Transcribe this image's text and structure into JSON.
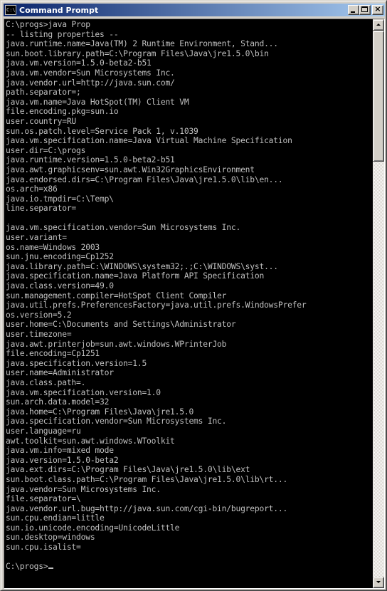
{
  "window": {
    "title": "Command Prompt",
    "icon_name": "console-icon",
    "icon_text": "C:\\",
    "buttons": [
      "minimize",
      "maximize",
      "close"
    ],
    "close_glyph": "×"
  },
  "colors": {
    "title_start": "#0a246a",
    "title_end": "#a6caf0",
    "console_bg": "#000000",
    "console_fg": "#c0c0c0",
    "chrome": "#d4d0c8"
  },
  "console": {
    "lines": [
      "C:\\progs>java Prop",
      "-- listing properties --",
      "java.runtime.name=Java(TM) 2 Runtime Environment, Stand...",
      "sun.boot.library.path=C:\\Program Files\\Java\\jre1.5.0\\bin",
      "java.vm.version=1.5.0-beta2-b51",
      "java.vm.vendor=Sun Microsystems Inc.",
      "java.vendor.url=http://java.sun.com/",
      "path.separator=;",
      "java.vm.name=Java HotSpot(TM) Client VM",
      "file.encoding.pkg=sun.io",
      "user.country=RU",
      "sun.os.patch.level=Service Pack 1, v.1039",
      "java.vm.specification.name=Java Virtual Machine Specification",
      "user.dir=C:\\progs",
      "java.runtime.version=1.5.0-beta2-b51",
      "java.awt.graphicsenv=sun.awt.Win32GraphicsEnvironment",
      "java.endorsed.dirs=C:\\Program Files\\Java\\jre1.5.0\\lib\\en...",
      "os.arch=x86",
      "java.io.tmpdir=C:\\Temp\\",
      "line.separator=",
      "",
      "java.vm.specification.vendor=Sun Microsystems Inc.",
      "user.variant=",
      "os.name=Windows 2003",
      "sun.jnu.encoding=Cp1252",
      "java.library.path=C:\\WINDOWS\\system32;.;C:\\WINDOWS\\syst...",
      "java.specification.name=Java Platform API Specification",
      "java.class.version=49.0",
      "sun.management.compiler=HotSpot Client Compiler",
      "java.util.prefs.PreferencesFactory=java.util.prefs.WindowsPrefer",
      "os.version=5.2",
      "user.home=C:\\Documents and Settings\\Administrator",
      "user.timezone=",
      "java.awt.printerjob=sun.awt.windows.WPrinterJob",
      "file.encoding=Cp1251",
      "java.specification.version=1.5",
      "user.name=Administrator",
      "java.class.path=.",
      "java.vm.specification.version=1.0",
      "sun.arch.data.model=32",
      "java.home=C:\\Program Files\\Java\\jre1.5.0",
      "java.specification.vendor=Sun Microsystems Inc.",
      "user.language=ru",
      "awt.toolkit=sun.awt.windows.WToolkit",
      "java.vm.info=mixed mode",
      "java.version=1.5.0-beta2",
      "java.ext.dirs=C:\\Program Files\\Java\\jre1.5.0\\lib\\ext",
      "sun.boot.class.path=C:\\Program Files\\Java\\jre1.5.0\\lib\\rt...",
      "java.vendor=Sun Microsystems Inc.",
      "file.separator=\\",
      "java.vendor.url.bug=http://java.sun.com/cgi-bin/bugreport...",
      "sun.cpu.endian=little",
      "sun.io.unicode.encoding=UnicodeLittle",
      "sun.desktop=windows",
      "sun.cpu.isalist=",
      ""
    ],
    "prompt": "C:\\progs>"
  },
  "scrollbar": {
    "position_fraction": 0.0,
    "visible_fraction": 0.24
  }
}
